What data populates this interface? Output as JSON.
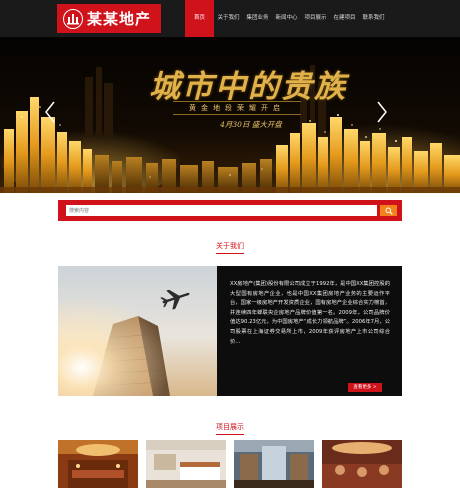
{
  "header": {
    "logo_text": "某某地产",
    "nav": [
      {
        "label": "首页",
        "active": true
      },
      {
        "label": "关于我们",
        "active": false
      },
      {
        "label": "集团业务",
        "active": false
      },
      {
        "label": "新闻中心",
        "active": false
      },
      {
        "label": "项目展示",
        "active": false
      },
      {
        "label": "在建项目",
        "active": false
      },
      {
        "label": "联系我们",
        "active": false
      }
    ]
  },
  "banner": {
    "title": "城市中的贵族",
    "subtitle": "黄金地段荣耀开启",
    "date": "4月30日 盛大开盘"
  },
  "search": {
    "placeholder": "搜索内容"
  },
  "about": {
    "heading": "关于我们",
    "text": "XX房地产(集团)股份有限公司成立于1992年，是中国XX集团控股的大型国有房地产企业，也是中国XX集团房地产业务的主要运作平台，国家一级房地产开发资质企业，国有房地产企业综合实力榜首，并连续四年蝉联央企房地产品牌价值第一名。2009年，公司品牌价值达90.23亿元，为中国房地产“成长力领航品牌”。2006年7月，公司股票在上海证券交易所上市，2009年获评房地产上市公司综合价...",
    "more_label": "查看更多 >"
  },
  "projects": {
    "heading": "项目展示"
  },
  "colors": {
    "brand_red": "#d0121b",
    "search_orange": "#f3811c",
    "header_dark": "#1a1a1a",
    "gold": "#e2b24a"
  }
}
